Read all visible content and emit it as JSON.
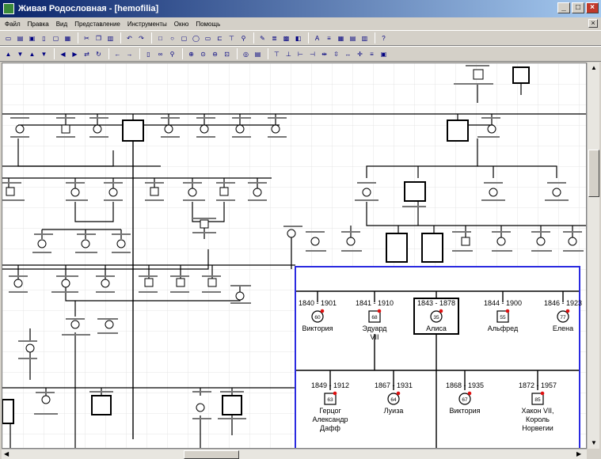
{
  "window": {
    "title": "Живая Родословная - [hemofilia]",
    "minimize": "_",
    "maximize": "□",
    "close": "×"
  },
  "menu": {
    "items": [
      "Файл",
      "Правка",
      "Вид",
      "Представление",
      "Инструменты",
      "Окно",
      "Помощь"
    ],
    "mdi_close": "×"
  },
  "zoom_panel": {
    "row1": [
      {
        "dates": "1840 - 1901",
        "age": "60",
        "name": [
          "Виктория"
        ],
        "highlight": false
      },
      {
        "dates": "1841 - 1910",
        "age": "68",
        "name": [
          "Эдуард",
          "VII"
        ],
        "highlight": false
      },
      {
        "dates": "1843 - 1878",
        "age": "35",
        "name": [
          "Алиса"
        ],
        "highlight": true
      },
      {
        "dates": "1844 - 1900",
        "age": "55",
        "name": [
          "Альфред"
        ],
        "highlight": false
      },
      {
        "dates": "1846 - 1923",
        "age": "77",
        "name": [
          "Елена"
        ],
        "highlight": false
      }
    ],
    "row2": [
      {
        "dates": "1849 - 1912",
        "age": "63",
        "name": [
          "Герцог",
          "Александр",
          "Дафф"
        ]
      },
      {
        "dates": "1867 - 1931",
        "age": "64",
        "name": [
          "Луиза"
        ]
      },
      {
        "dates": "1868 - 1935",
        "age": "67",
        "name": [
          "Виктория"
        ]
      },
      {
        "dates": "1872 - 1957",
        "age": "85",
        "name": [
          "Хакон VII,",
          "Король",
          "Норвегии"
        ]
      }
    ]
  },
  "colors": {
    "zoom_border": "#2a2ae0",
    "marker": "#e01010",
    "line": "#000000"
  }
}
